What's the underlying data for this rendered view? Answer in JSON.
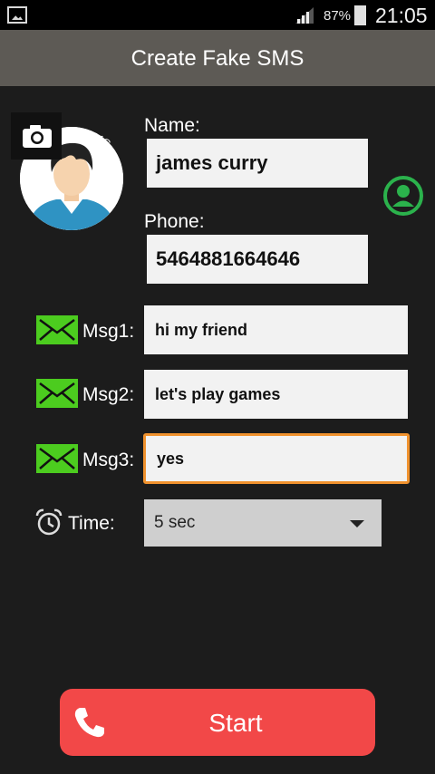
{
  "status_bar": {
    "battery_text": "87%",
    "time": "21:05"
  },
  "app_bar": {
    "title": "Create Fake SMS"
  },
  "avatar": {
    "arc_text": "all & SMS"
  },
  "form": {
    "name_label": "Name:",
    "name_value": "james curry",
    "phone_label": "Phone:",
    "phone_value": "5464881664646",
    "msg1_label": "Msg1:",
    "msg1_value": "hi my friend",
    "msg2_label": "Msg2:",
    "msg2_value": "let's play games",
    "msg3_label": "Msg3:",
    "msg3_value": "yes",
    "time_label": "Time:",
    "time_value": "5 sec"
  },
  "start_label": "Start",
  "colors": {
    "accent_green": "#4ccc1f",
    "start_red": "#f24848",
    "focus_orange": "#f0922e",
    "appbar": "#5d5a55"
  },
  "icons": [
    "gallery-icon",
    "signal-icon",
    "battery-icon",
    "camera-icon",
    "contact-icon",
    "message-icon",
    "alarm-clock-icon",
    "dropdown-arrow-icon",
    "phone-icon"
  ]
}
